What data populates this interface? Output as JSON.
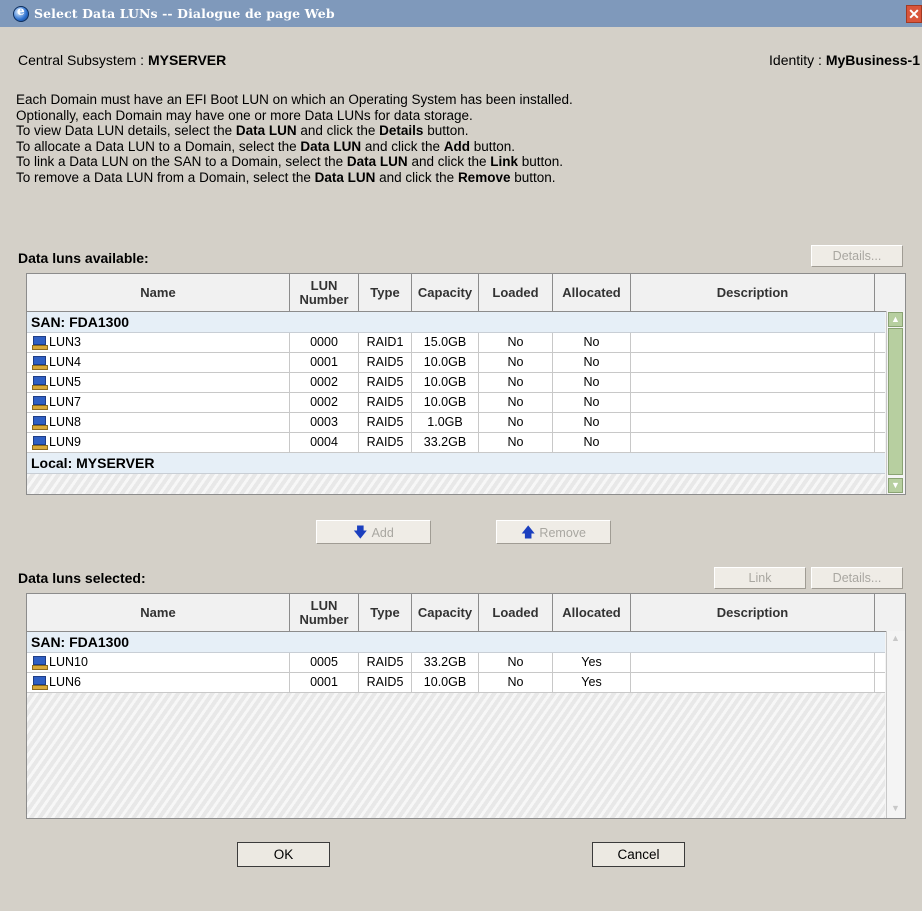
{
  "window": {
    "title": "Select Data LUNs -- Dialogue de page Web",
    "close_glyph": "✕"
  },
  "header": {
    "subsystem_label": "Central Subsystem : ",
    "subsystem_value": "MYSERVER",
    "identity_label": "Identity : ",
    "identity_value": "MyBusiness-1"
  },
  "instructions": [
    {
      "parts": [
        {
          "t": "Each Domain must have an EFI Boot LUN on which an Operating System has been installed.",
          "b": false
        }
      ]
    },
    {
      "parts": [
        {
          "t": "Optionally, each Domain may have one or more Data LUNs for data storage.",
          "b": false
        }
      ]
    },
    {
      "parts": [
        {
          "t": "To view Data LUN details, select the ",
          "b": false
        },
        {
          "t": "Data LUN",
          "b": true
        },
        {
          "t": " and click the ",
          "b": false
        },
        {
          "t": "Details",
          "b": true
        },
        {
          "t": " button.",
          "b": false
        }
      ]
    },
    {
      "parts": [
        {
          "t": "To allocate a Data LUN to a Domain, select the ",
          "b": false
        },
        {
          "t": "Data LUN",
          "b": true
        },
        {
          "t": " and click the ",
          "b": false
        },
        {
          "t": "Add",
          "b": true
        },
        {
          "t": " button.",
          "b": false
        }
      ]
    },
    {
      "parts": [
        {
          "t": "To link a Data LUN on the SAN to a Domain, select the ",
          "b": false
        },
        {
          "t": "Data LUN",
          "b": true
        },
        {
          "t": " and click the ",
          "b": false
        },
        {
          "t": "Link",
          "b": true
        },
        {
          "t": " button.",
          "b": false
        }
      ]
    },
    {
      "parts": [
        {
          "t": "To remove a Data LUN from a Domain, select the ",
          "b": false
        },
        {
          "t": "Data LUN",
          "b": true
        },
        {
          "t": " and click the ",
          "b": false
        },
        {
          "t": "Remove",
          "b": true
        },
        {
          "t": " button.",
          "b": false
        }
      ]
    }
  ],
  "available": {
    "label": "Data luns available:",
    "details_button": "Details...",
    "columns": [
      "Name",
      "LUN\nNumber",
      "Type",
      "Capacity",
      "Loaded",
      "Allocated",
      "Description"
    ],
    "groups": [
      {
        "name": "SAN: FDA1300",
        "rows": [
          {
            "name": "LUN3",
            "number": "0000",
            "type": "RAID1",
            "capacity": "15.0GB",
            "loaded": "No",
            "allocated": "No",
            "description": ""
          },
          {
            "name": "LUN4",
            "number": "0001",
            "type": "RAID5",
            "capacity": "10.0GB",
            "loaded": "No",
            "allocated": "No",
            "description": ""
          },
          {
            "name": "LUN5",
            "number": "0002",
            "type": "RAID5",
            "capacity": "10.0GB",
            "loaded": "No",
            "allocated": "No",
            "description": ""
          },
          {
            "name": "LUN7",
            "number": "0002",
            "type": "RAID5",
            "capacity": "10.0GB",
            "loaded": "No",
            "allocated": "No",
            "description": ""
          },
          {
            "name": "LUN8",
            "number": "0003",
            "type": "RAID5",
            "capacity": "1.0GB",
            "loaded": "No",
            "allocated": "No",
            "description": ""
          },
          {
            "name": "LUN9",
            "number": "0004",
            "type": "RAID5",
            "capacity": "33.2GB",
            "loaded": "No",
            "allocated": "No",
            "description": ""
          }
        ]
      },
      {
        "name": "Local: MYSERVER",
        "rows": []
      }
    ]
  },
  "actions": {
    "add_label": "Add",
    "add_icon": "arrow-down-icon",
    "remove_label": "Remove",
    "remove_icon": "arrow-up-icon"
  },
  "selected": {
    "label": "Data luns selected:",
    "link_button": "Link",
    "details_button": "Details...",
    "columns": [
      "Name",
      "LUN\nNumber",
      "Type",
      "Capacity",
      "Loaded",
      "Allocated",
      "Description"
    ],
    "groups": [
      {
        "name": "SAN: FDA1300",
        "rows": [
          {
            "name": "LUN10",
            "number": "0005",
            "type": "RAID5",
            "capacity": "33.2GB",
            "loaded": "No",
            "allocated": "Yes",
            "description": ""
          },
          {
            "name": "LUN6",
            "number": "0001",
            "type": "RAID5",
            "capacity": "10.0GB",
            "loaded": "No",
            "allocated": "Yes",
            "description": ""
          }
        ]
      }
    ]
  },
  "footer": {
    "ok_label": "OK",
    "cancel_label": "Cancel"
  },
  "colors": {
    "titlebar": "#7f99bb",
    "dialog_bg": "#d4d0c8",
    "group_row_bg": "#e6eff7",
    "scroll_thumb": "#b7cfa0"
  }
}
